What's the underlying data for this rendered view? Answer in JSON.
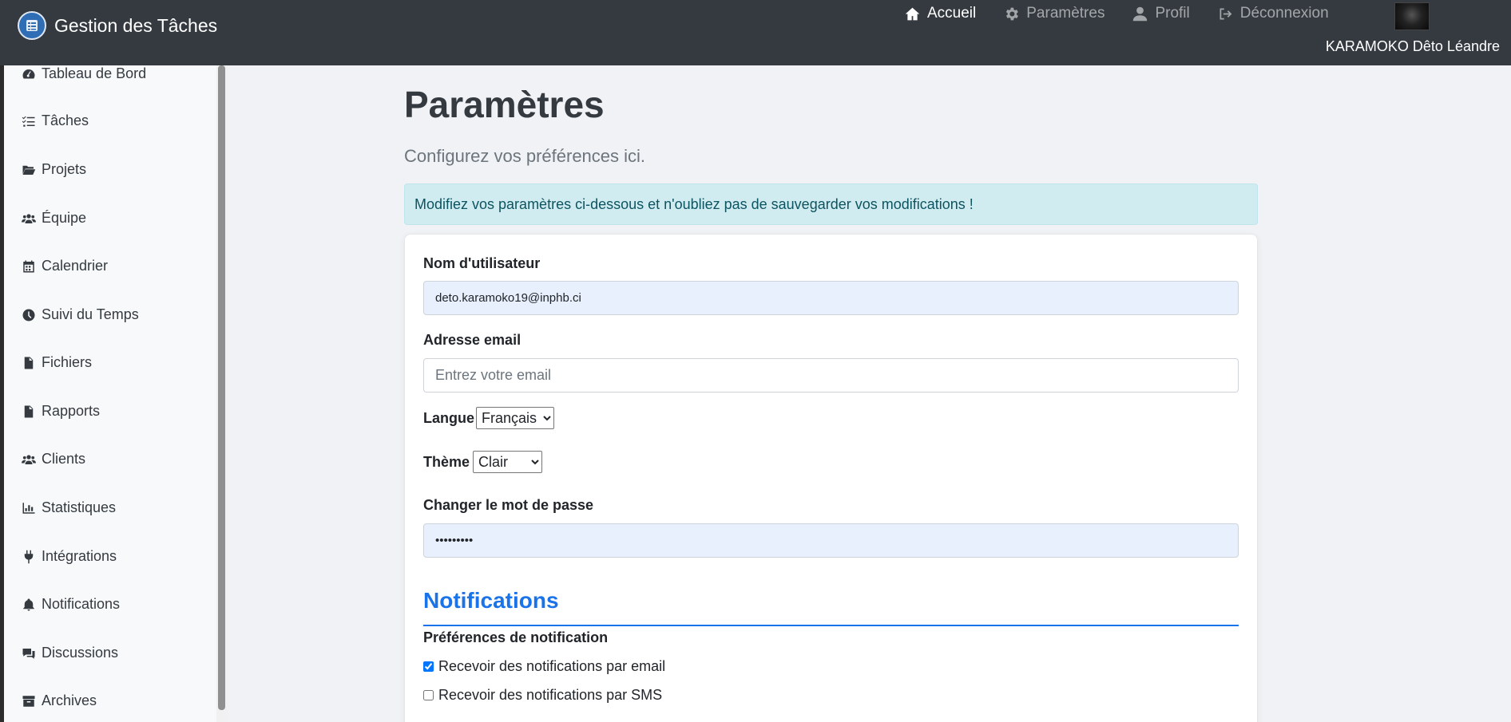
{
  "app": {
    "title": "Gestion des Tâches"
  },
  "nav": {
    "items": [
      {
        "label": "Accueil",
        "icon": "home-icon",
        "active": true
      },
      {
        "label": "Paramètres",
        "icon": "gear-icon",
        "active": false
      },
      {
        "label": "Profil",
        "icon": "user-icon",
        "active": false
      },
      {
        "label": "Déconnexion",
        "icon": "logout-icon",
        "active": false
      }
    ],
    "user_name": "KARAMOKO Dêto Léandre"
  },
  "sidebar": {
    "items": [
      {
        "label": "Tableau de Bord",
        "icon": "dashboard-icon"
      },
      {
        "label": "Tâches",
        "icon": "task-list-icon"
      },
      {
        "label": "Projets",
        "icon": "folder-open-icon"
      },
      {
        "label": "Équipe",
        "icon": "users-icon"
      },
      {
        "label": "Calendrier",
        "icon": "calendar-icon"
      },
      {
        "label": "Suivi du Temps",
        "icon": "clock-icon"
      },
      {
        "label": "Fichiers",
        "icon": "file-icon"
      },
      {
        "label": "Rapports",
        "icon": "file-text-icon"
      },
      {
        "label": "Clients",
        "icon": "users-icon"
      },
      {
        "label": "Statistiques",
        "icon": "chart-icon"
      },
      {
        "label": "Intégrations",
        "icon": "plug-icon"
      },
      {
        "label": "Notifications",
        "icon": "bell-icon"
      },
      {
        "label": "Discussions",
        "icon": "comments-icon"
      },
      {
        "label": "Archives",
        "icon": "archive-icon"
      }
    ]
  },
  "main": {
    "title": "Paramètres",
    "subtitle": "Configurez vos préférences ici.",
    "alert": "Modifiez vos paramètres ci-dessous et n'oubliez pas de sauvegarder vos modifications !",
    "form": {
      "username_label": "Nom d'utilisateur",
      "username_value": "deto.karamoko19@inphb.ci",
      "email_label": "Adresse email",
      "email_placeholder": "Entrez votre email",
      "language_label": "Langue",
      "language_value": "Français",
      "theme_label": "Thème",
      "theme_value": "Clair",
      "password_label": "Changer le mot de passe",
      "password_value": "•••••••••"
    },
    "notifications": {
      "section_title": "Notifications",
      "preferences_label": "Préférences de notification",
      "options": [
        {
          "label": "Recevoir des notifications par email",
          "checked": true
        },
        {
          "label": "Recevoir des notifications par SMS",
          "checked": false
        }
      ]
    }
  }
}
